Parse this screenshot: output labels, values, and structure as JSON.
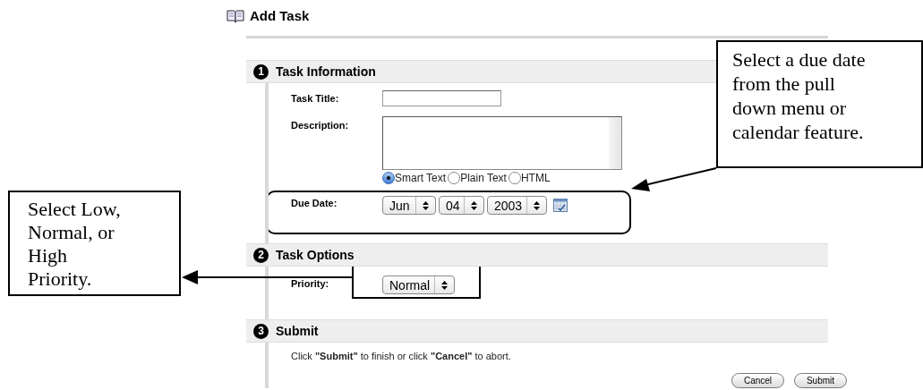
{
  "page": {
    "title": "Add Task"
  },
  "sections": [
    {
      "number": "1",
      "title": "Task Information",
      "fields": [
        {
          "kind": "text",
          "label": "Task Title:"
        },
        {
          "kind": "textarea",
          "label": "Description:",
          "options": [
            {
              "label": "Smart Text",
              "selected": true
            },
            {
              "label": "Plain Text",
              "selected": false
            },
            {
              "label": "HTML",
              "selected": false
            }
          ]
        },
        {
          "kind": "date",
          "label": "Due Date:",
          "month": "Jun",
          "day": "04",
          "year": "2003"
        }
      ]
    },
    {
      "number": "2",
      "title": "Task Options",
      "fields": [
        {
          "kind": "select",
          "label": "Priority:",
          "value": "Normal"
        }
      ]
    },
    {
      "number": "3",
      "title": "Submit",
      "instructions": "Click **\"Submit\"** to finish or click **\"Cancel\"** to abort.",
      "buttons": [
        "Cancel",
        "Submit"
      ]
    }
  ],
  "callouts": [
    {
      "text": "Select a due date\nfrom the pull\ndown menu or\ncalendar feature."
    },
    {
      "text": "Select Low,\nNormal, or\nHigh\nPriority."
    }
  ]
}
